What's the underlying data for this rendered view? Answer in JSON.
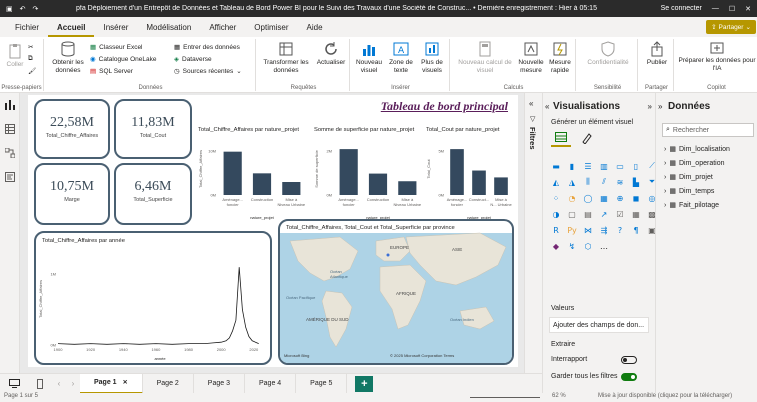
{
  "titlebar": {
    "title": "pfa Déploiement d'un Entrepôt de Données et Tableau de Bord Power BI pour le Suivi des Travaux d'une Société de Construc... • Dernière enregistrement : Hier à 05:15",
    "signin": "Se connecter",
    "colors": {
      "bg": "#2b2b2b"
    }
  },
  "menu": [
    "Fichier",
    "Accueil",
    "Insérer",
    "Modélisation",
    "Afficher",
    "Optimiser",
    "Aide"
  ],
  "ribbon": {
    "coller": "Coller",
    "presse_papiers": "Presse-papiers",
    "obtenir_donnees": "Obtenir les données",
    "classeur_excel": "Classeur Excel",
    "catalogue_onelake": "Catalogue OneLake",
    "sql_server": "SQL Server",
    "entrer_donnees": "Entrer des données",
    "dataverse": "Dataverse",
    "sources_recentes": "Sources récentes",
    "donnees": "Données",
    "transformer": "Transformer les données",
    "actualiser": "Actualiser",
    "requetes": "Requêtes",
    "nouveau_visuel": "Nouveau visuel",
    "zone_texte": "Zone de texte",
    "plus_visuels": "Plus de visuels",
    "inserer": "Insérer",
    "nouveau_calcul": "Nouveau calcul de visuel",
    "nouvelle_mesure": "Nouvelle mesure",
    "mesure_rapide": "Mesure rapide",
    "calculs": "Calculs",
    "confidentialite": "Confidentialité",
    "sensibilite": "Sensibilité",
    "publier": "Publier",
    "partager_group": "Partager",
    "preparer_ia": "Préparer les données pour l'IA",
    "copilot": "Copilot",
    "partager_btn": "Partager"
  },
  "dashboard": {
    "title": "Tableau de bord principal",
    "kpis": [
      {
        "value": "22,58M",
        "label": "Total_Chiffre_Affaires"
      },
      {
        "value": "11,83M",
        "label": "Total_Cout"
      },
      {
        "value": "10,75M",
        "label": "Marge"
      },
      {
        "value": "6,46M",
        "label": "Total_Superficie"
      }
    ],
    "map_title": "Total_Chiffre_Affaires, Total_Cout et Total_Superficie par province",
    "map_labels": {
      "europe": "EUROPE",
      "asie": "ASIE",
      "afrique": "AFRIQUE",
      "amerique_sud": "AMÉRIQUE DU SUD",
      "ocean_atl": "Océan Atlantique",
      "ocean_ind": "Océan Indien",
      "ocean_pac": "Océan Pacifique",
      "copyright": "© 2025 Microsoft Corporation  Terms",
      "bing": "Microsoft Bing"
    },
    "line_title": "Total_Chiffre_Affaires par année"
  },
  "chart_data": [
    {
      "type": "bar",
      "title": "Total_Chiffre_Affaires par nature_projet",
      "xlabel": "nature_projet",
      "ylabel": "Total_Chiffre_Affaires",
      "categories": [
        "Aménage... foncier",
        "Construction",
        "Mise à Niveau Urbaine"
      ],
      "values": [
        10,
        5,
        3
      ],
      "yticks": [
        "10M",
        "0M"
      ],
      "ylim": [
        0,
        12
      ]
    },
    {
      "type": "bar",
      "title": "Somme de superficie par nature_projet",
      "xlabel": "nature_projet",
      "ylabel": "Somme de superficie",
      "categories": [
        "Aménage... foncier",
        "Construction",
        "Mise à Niveau Urbaine"
      ],
      "values": [
        3.0,
        1.4,
        0.9
      ],
      "yticks": [
        "2M",
        "0M"
      ],
      "ylim": [
        0,
        3.4
      ]
    },
    {
      "type": "bar",
      "title": "Total_Cout par nature_projet",
      "xlabel": "nature_projet",
      "ylabel": "Total_Cout",
      "categories": [
        "Aménage... foncier",
        "Construct...",
        "Mise à N... Urbaine"
      ],
      "values": [
        6.0,
        3.2,
        2.3
      ],
      "yticks": [
        "5M",
        "0M"
      ],
      "ylim": [
        0,
        6.8
      ]
    },
    {
      "type": "line",
      "title": "Total_Chiffre_Affaires par année",
      "xlabel": "année",
      "ylabel": "Total_Chiffre_Affaires",
      "xticks": [
        "1900",
        "1920",
        "1940",
        "1960",
        "1980",
        "2000",
        "2020"
      ],
      "yticks": [
        "1M",
        "0M"
      ],
      "xlim": [
        1900,
        2025
      ],
      "ylim": [
        0,
        1.3
      ],
      "x": [
        1900,
        1910,
        1920,
        1930,
        1940,
        1950,
        1960,
        1970,
        1980,
        1990,
        1995,
        2000,
        2003,
        2005,
        2007,
        2009,
        2011,
        2013,
        2015,
        2017,
        2019,
        2021,
        2023
      ],
      "y": [
        0.02,
        0.01,
        0.02,
        0.01,
        0.02,
        0.01,
        0.02,
        0.01,
        0.02,
        0.02,
        0.03,
        0.04,
        0.06,
        0.1,
        0.2,
        0.35,
        1.1,
        0.5,
        0.25,
        0.12,
        0.06,
        0.04,
        0.02
      ]
    }
  ],
  "filters_label": "Filtres",
  "viz_pane": {
    "title": "Visualisations",
    "subtitle": "Générer un élément visuel",
    "valeurs": "Valeurs",
    "ajouter": "Ajouter des champs de don...",
    "extraire": "Extraire",
    "interrapport": "Interrapport",
    "garder": "Garder tous les filtres"
  },
  "data_pane": {
    "title": "Données",
    "search_placeholder": "Rechercher",
    "tables": [
      "Dim_localisation",
      "Dim_operation",
      "Dim_projet",
      "Dim_temps",
      "Fait_pilotage"
    ]
  },
  "tabs": [
    "Page 1",
    "Page 2",
    "Page 3",
    "Page 4",
    "Page 5"
  ],
  "status": {
    "page": "Page 1 sur 5",
    "zoom": "62 %",
    "update": "Mise à jour disponible (cliquez pour la télécharger)"
  },
  "colors": {
    "bar": "#34495e",
    "accent": "#b69700",
    "frame": "#4a6072",
    "title": "#5a1e5a"
  }
}
